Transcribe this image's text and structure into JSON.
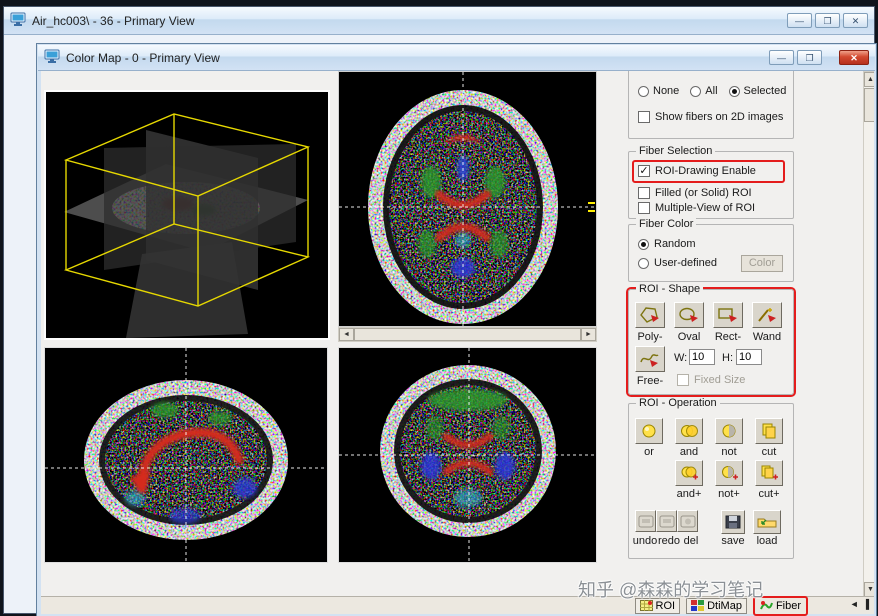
{
  "outer_window": {
    "title": "Air_hc003\\ - 36 - Primary View",
    "buttons": {
      "minimize": "—",
      "maximize": "❐",
      "close": "✕"
    }
  },
  "inner_window": {
    "title": "Color Map - 0 - Primary View",
    "buttons": {
      "minimize": "—",
      "maximize": "❐",
      "close": "✕"
    }
  },
  "fiber_display": {
    "options": [
      {
        "label": "None",
        "selected": false
      },
      {
        "label": "All",
        "selected": false
      },
      {
        "label": "Selected",
        "selected": true
      }
    ],
    "show_fibers_2d": {
      "label": "Show fibers on 2D images",
      "checked": false,
      "glyph": ""
    }
  },
  "fiber_selection": {
    "title": "Fiber Selection",
    "items": [
      {
        "label": "ROI-Drawing Enable",
        "checked": true,
        "glyph": "✓",
        "highlighted": true
      },
      {
        "label": "Filled (or Solid) ROI",
        "checked": false,
        "glyph": ""
      },
      {
        "label": "Multiple-View of ROI",
        "checked": false,
        "glyph": ""
      }
    ]
  },
  "fiber_color": {
    "title": "Fiber Color",
    "options": [
      {
        "label": "Random",
        "selected": true
      },
      {
        "label": "User-defined",
        "selected": false
      }
    ],
    "color_button": "Color"
  },
  "roi_shape": {
    "title": "ROI - Shape",
    "highlighted": true,
    "tools": [
      {
        "label": "Poly-"
      },
      {
        "label": "Oval"
      },
      {
        "label": "Rect-"
      },
      {
        "label": "Wand"
      },
      {
        "label": "Free-"
      }
    ],
    "w_label": "W:",
    "w_value": "10",
    "h_label": "H:",
    "h_value": "10",
    "fixed_size_label": "Fixed Size",
    "fixed_size_checked": false
  },
  "roi_operation": {
    "title": "ROI - Operation",
    "row1": [
      "or",
      "and",
      "not",
      "cut"
    ],
    "row2": [
      "and+",
      "not+",
      "cut+"
    ],
    "row3": [
      "undo",
      "redo",
      "del",
      "save",
      "load"
    ]
  },
  "bottom_toolbar": {
    "buttons": [
      {
        "label": "ROI",
        "highlighted": false
      },
      {
        "label": "DtiMap",
        "highlighted": false
      },
      {
        "label": "Fiber",
        "highlighted": true
      }
    ],
    "overflow": {
      "left": "◄",
      "grip": "▐"
    }
  },
  "scrollbar": {
    "up": "▲",
    "down": "▼",
    "left": "◄",
    "right": "►"
  },
  "watermark": "知乎 @森森的学习笔记"
}
